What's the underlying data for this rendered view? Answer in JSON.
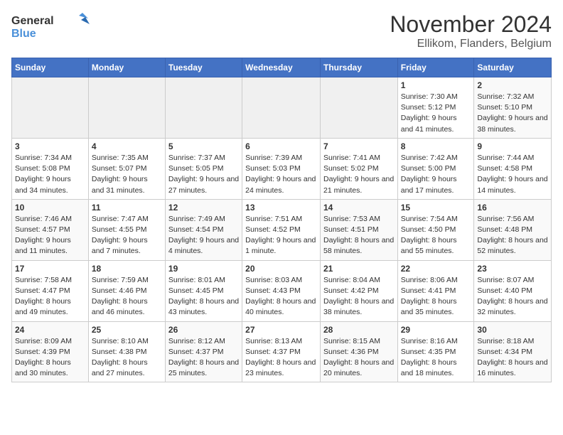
{
  "header": {
    "logo_line1": "General",
    "logo_line2": "Blue",
    "title": "November 2024",
    "subtitle": "Ellikom, Flanders, Belgium"
  },
  "weekdays": [
    "Sunday",
    "Monday",
    "Tuesday",
    "Wednesday",
    "Thursday",
    "Friday",
    "Saturday"
  ],
  "weeks": [
    [
      {
        "day": "",
        "info": ""
      },
      {
        "day": "",
        "info": ""
      },
      {
        "day": "",
        "info": ""
      },
      {
        "day": "",
        "info": ""
      },
      {
        "day": "",
        "info": ""
      },
      {
        "day": "1",
        "info": "Sunrise: 7:30 AM\nSunset: 5:12 PM\nDaylight: 9 hours and 41 minutes."
      },
      {
        "day": "2",
        "info": "Sunrise: 7:32 AM\nSunset: 5:10 PM\nDaylight: 9 hours and 38 minutes."
      }
    ],
    [
      {
        "day": "3",
        "info": "Sunrise: 7:34 AM\nSunset: 5:08 PM\nDaylight: 9 hours and 34 minutes."
      },
      {
        "day": "4",
        "info": "Sunrise: 7:35 AM\nSunset: 5:07 PM\nDaylight: 9 hours and 31 minutes."
      },
      {
        "day": "5",
        "info": "Sunrise: 7:37 AM\nSunset: 5:05 PM\nDaylight: 9 hours and 27 minutes."
      },
      {
        "day": "6",
        "info": "Sunrise: 7:39 AM\nSunset: 5:03 PM\nDaylight: 9 hours and 24 minutes."
      },
      {
        "day": "7",
        "info": "Sunrise: 7:41 AM\nSunset: 5:02 PM\nDaylight: 9 hours and 21 minutes."
      },
      {
        "day": "8",
        "info": "Sunrise: 7:42 AM\nSunset: 5:00 PM\nDaylight: 9 hours and 17 minutes."
      },
      {
        "day": "9",
        "info": "Sunrise: 7:44 AM\nSunset: 4:58 PM\nDaylight: 9 hours and 14 minutes."
      }
    ],
    [
      {
        "day": "10",
        "info": "Sunrise: 7:46 AM\nSunset: 4:57 PM\nDaylight: 9 hours and 11 minutes."
      },
      {
        "day": "11",
        "info": "Sunrise: 7:47 AM\nSunset: 4:55 PM\nDaylight: 9 hours and 7 minutes."
      },
      {
        "day": "12",
        "info": "Sunrise: 7:49 AM\nSunset: 4:54 PM\nDaylight: 9 hours and 4 minutes."
      },
      {
        "day": "13",
        "info": "Sunrise: 7:51 AM\nSunset: 4:52 PM\nDaylight: 9 hours and 1 minute."
      },
      {
        "day": "14",
        "info": "Sunrise: 7:53 AM\nSunset: 4:51 PM\nDaylight: 8 hours and 58 minutes."
      },
      {
        "day": "15",
        "info": "Sunrise: 7:54 AM\nSunset: 4:50 PM\nDaylight: 8 hours and 55 minutes."
      },
      {
        "day": "16",
        "info": "Sunrise: 7:56 AM\nSunset: 4:48 PM\nDaylight: 8 hours and 52 minutes."
      }
    ],
    [
      {
        "day": "17",
        "info": "Sunrise: 7:58 AM\nSunset: 4:47 PM\nDaylight: 8 hours and 49 minutes."
      },
      {
        "day": "18",
        "info": "Sunrise: 7:59 AM\nSunset: 4:46 PM\nDaylight: 8 hours and 46 minutes."
      },
      {
        "day": "19",
        "info": "Sunrise: 8:01 AM\nSunset: 4:45 PM\nDaylight: 8 hours and 43 minutes."
      },
      {
        "day": "20",
        "info": "Sunrise: 8:03 AM\nSunset: 4:43 PM\nDaylight: 8 hours and 40 minutes."
      },
      {
        "day": "21",
        "info": "Sunrise: 8:04 AM\nSunset: 4:42 PM\nDaylight: 8 hours and 38 minutes."
      },
      {
        "day": "22",
        "info": "Sunrise: 8:06 AM\nSunset: 4:41 PM\nDaylight: 8 hours and 35 minutes."
      },
      {
        "day": "23",
        "info": "Sunrise: 8:07 AM\nSunset: 4:40 PM\nDaylight: 8 hours and 32 minutes."
      }
    ],
    [
      {
        "day": "24",
        "info": "Sunrise: 8:09 AM\nSunset: 4:39 PM\nDaylight: 8 hours and 30 minutes."
      },
      {
        "day": "25",
        "info": "Sunrise: 8:10 AM\nSunset: 4:38 PM\nDaylight: 8 hours and 27 minutes."
      },
      {
        "day": "26",
        "info": "Sunrise: 8:12 AM\nSunset: 4:37 PM\nDaylight: 8 hours and 25 minutes."
      },
      {
        "day": "27",
        "info": "Sunrise: 8:13 AM\nSunset: 4:37 PM\nDaylight: 8 hours and 23 minutes."
      },
      {
        "day": "28",
        "info": "Sunrise: 8:15 AM\nSunset: 4:36 PM\nDaylight: 8 hours and 20 minutes."
      },
      {
        "day": "29",
        "info": "Sunrise: 8:16 AM\nSunset: 4:35 PM\nDaylight: 8 hours and 18 minutes."
      },
      {
        "day": "30",
        "info": "Sunrise: 8:18 AM\nSunset: 4:34 PM\nDaylight: 8 hours and 16 minutes."
      }
    ]
  ]
}
